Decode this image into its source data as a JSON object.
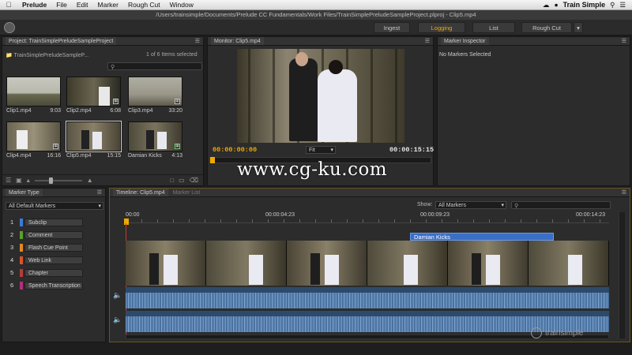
{
  "menubar": {
    "app": "Prelude",
    "items": [
      "File",
      "Edit",
      "Marker",
      "Rough Cut",
      "Window"
    ],
    "brand": "Train Simple"
  },
  "titlebar": {
    "path": "/Users/trainsimple/Documents/Prelude CC Fundamentals/Work Files/TrainSimplePreludeSampleProject.plproj - Clip5.mp4"
  },
  "workspaces": [
    {
      "label": "Ingest",
      "active": false
    },
    {
      "label": "Logging",
      "active": true
    },
    {
      "label": "List",
      "active": false
    },
    {
      "label": "Rough Cut",
      "active": false
    }
  ],
  "project": {
    "title": "Project: TrainSimplePreludeSampleProject",
    "folder": "TrainSimplePreludeSampleP...",
    "selection": "1 of 6 Items selected",
    "clips": [
      {
        "name": "Clip1.mp4",
        "dur": "9:03"
      },
      {
        "name": "Clip2.mp4",
        "dur": "6:08"
      },
      {
        "name": "Clip3.mp4",
        "dur": "33:20"
      },
      {
        "name": "Clip4.mp4",
        "dur": "16:16"
      },
      {
        "name": "Clip5.mp4",
        "dur": "15:15"
      },
      {
        "name": "Damian Kicks",
        "dur": "4:13"
      }
    ]
  },
  "monitor": {
    "title": "Monitor: Clip5.mp4",
    "timecode_in": "00:00:00:00",
    "zoom": "Fit",
    "duration": "00:00:15:15"
  },
  "inspector": {
    "title": "Marker Inspector",
    "empty": "No Markers Selected"
  },
  "marker_type": {
    "title": "Marker Type",
    "filter": "All Default Markers",
    "items": [
      {
        "num": "1",
        "label": "Subclip",
        "color": "#3a7bd5"
      },
      {
        "num": "2",
        "label": "Comment",
        "color": "#5aa02c"
      },
      {
        "num": "3",
        "label": "Flash Cue Point",
        "color": "#e08a1e"
      },
      {
        "num": "4",
        "label": "Web Link",
        "color": "#d8542a"
      },
      {
        "num": "5",
        "label": "Chapter",
        "color": "#b83a3a"
      },
      {
        "num": "6",
        "label": "Speech Transcription",
        "color": "#b0307a"
      }
    ]
  },
  "timeline": {
    "tab": "Timeline: Clip5.mp4",
    "tab2": "Marker List",
    "show_label": "Show:",
    "show_value": "All Markers",
    "ruler": [
      "00:00",
      "00:00:04:23",
      "00:00:09:23",
      "00:00:14:23"
    ],
    "subclip": "Damian Kicks"
  },
  "watermark": "www.cg-ku.com",
  "corner_brand": "trainsimple"
}
